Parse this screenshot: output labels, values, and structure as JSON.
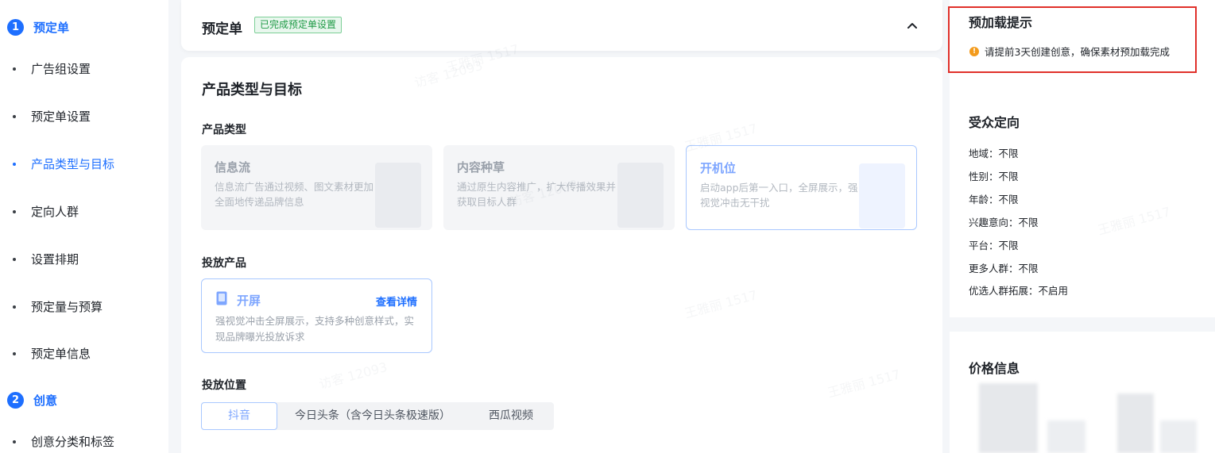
{
  "nav": {
    "steps": [
      {
        "num": "1",
        "label": "预定单"
      },
      {
        "num": "2",
        "label": "创意"
      }
    ],
    "items": [
      {
        "label": "广告组设置"
      },
      {
        "label": "预定单设置"
      },
      {
        "label": "产品类型与目标"
      },
      {
        "label": "定向人群"
      },
      {
        "label": "设置排期"
      },
      {
        "label": "预定量与预算"
      },
      {
        "label": "预定单信息"
      },
      {
        "label": "创意分类和标签"
      }
    ]
  },
  "header": {
    "title": "预定单",
    "badge": "已完成预定单设置"
  },
  "main": {
    "section_title": "产品类型与目标",
    "product_type_label": "产品类型",
    "product_types": [
      {
        "title": "信息流",
        "desc": "信息流广告通过视频、图文素材更加全面地传递品牌信息",
        "selected": false
      },
      {
        "title": "内容种草",
        "desc": "通过原生内容推广，扩大传播效果并获取目标人群",
        "selected": false
      },
      {
        "title": "开机位",
        "desc": "启动app后第一入口，全屏展示，强视觉冲击无干扰",
        "selected": true
      }
    ],
    "delivery_product_label": "投放产品",
    "delivery_product": {
      "title": "开屏",
      "link": "查看详情",
      "desc": "强视觉冲击全屏展示，支持多种创意样式，实现品牌曝光投放诉求"
    },
    "placement_label": "投放位置",
    "placements": [
      {
        "label": "抖音",
        "active": true
      },
      {
        "label": "今日头条（含今日头条极速版）",
        "active": false
      },
      {
        "label": "西瓜视频",
        "active": false
      }
    ]
  },
  "right": {
    "hint_title": "预加载提示",
    "hint_text": "请提前3天创建创意，确保素材预加载完成",
    "audience_title": "受众定向",
    "audience": [
      "地域：不限",
      "性别：不限",
      "年龄：不限",
      "兴趣意向：不限",
      "平台：不限",
      "更多人群：不限",
      "优选人群拓展：不启用"
    ],
    "price_title": "价格信息"
  },
  "watermarks": [
    "王雅丽 1517",
    "访客 12093"
  ],
  "colors": {
    "accent": "#1e6fff",
    "success": "#1e9a45",
    "highlight_border": "#e0302a",
    "warning": "#f39b1c"
  }
}
